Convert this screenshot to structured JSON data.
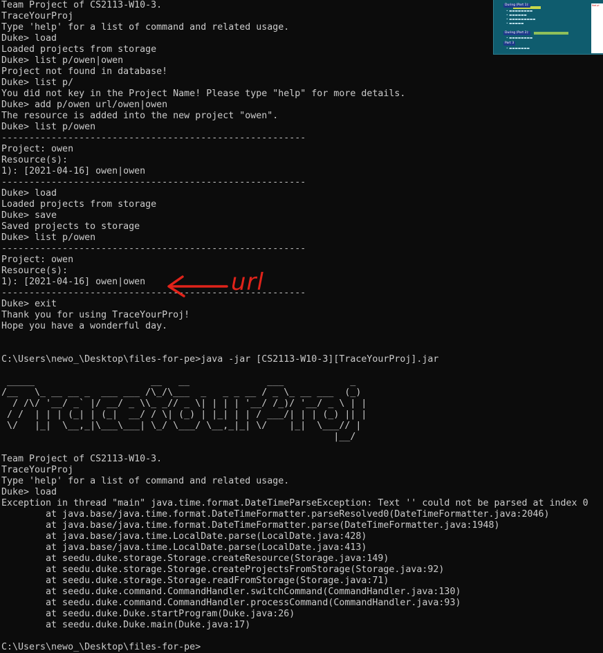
{
  "terminal": {
    "session_one": [
      "Team Project of CS2113-W10-3.",
      "TraceYourProj",
      "Type 'help' for a list of command and related usage.",
      "Duke> load",
      "Loaded projects from storage",
      "Duke> list p/owen|owen",
      "Project not found in database!",
      "Duke> list p/",
      "You did not key in the Project Name! Please type \"help\" for more details.",
      "Duke> add p/owen url/owen|owen",
      "The resource is added into the new project \"owen\".",
      "Duke> list p/owen"
    ],
    "divider": "-------------------------------------------------------",
    "list_block_one": [
      "Project: owen",
      "Resource(s):",
      "1): [2021-04-16] owen|owen"
    ],
    "middle_block": [
      "Duke> load",
      "Loaded projects from storage",
      "Duke> save",
      "Saved projects to storage",
      "Duke> list p/owen"
    ],
    "list_block_two": [
      "Project: owen",
      "Resource(s):",
      "1): [2021-04-16] owen|owen"
    ],
    "exit_block": [
      "Duke> exit",
      "Thank you for using TraceYourProj!",
      "Hope you have a wonderful day."
    ],
    "run_command": "C:\\Users\\newo_\\Desktop\\files-for-pe>java -jar [CS2113-W10-3][TraceYourProj].jar",
    "ascii_logo": [
      " _____                     __   __              ___            _ ",
      "/__   \\_ __ __ _  ___ ___ /\\_/\\___  _   _ _ __ / _ \\_ __ ___  (_)",
      "  / /\\/ '__/ _` |/ __/ _ \\\\_ _// _ \\| | | | '__/ /_)/ '__/ _ \\ | |",
      " / /  | | | (_| | (_|  __/ / \\| (_) | |_| | | / ___/| | | (_) || |",
      " \\/   |_|  \\__,_|\\___\\___| \\_/ \\___/ \\__,_|_| \\/    |_|  \\___// |",
      "                                                            |__/ "
    ],
    "session_two": [
      "Team Project of CS2113-W10-3.",
      "TraceYourProj",
      "Type 'help' for a list of command and related usage.",
      "Duke> load",
      "Exception in thread \"main\" java.time.format.DateTimeParseException: Text '' could not be parsed at index 0",
      "        at java.base/java.time.format.DateTimeFormatter.parseResolved0(DateTimeFormatter.java:2046)",
      "        at java.base/java.time.format.DateTimeFormatter.parse(DateTimeFormatter.java:1948)",
      "        at java.base/java.time.LocalDate.parse(LocalDate.java:428)",
      "        at java.base/java.time.LocalDate.parse(LocalDate.java:413)",
      "        at seedu.duke.storage.Storage.createResource(Storage.java:149)",
      "        at seedu.duke.storage.Storage.createProjectsFromStorage(Storage.java:92)",
      "        at seedu.duke.storage.Storage.readFromStorage(Storage.java:71)",
      "        at seedu.duke.command.CommandHandler.switchCommand(CommandHandler.java:130)",
      "        at seedu.duke.command.CommandHandler.processCommand(CommandHandler.java:93)",
      "        at seedu.duke.Duke.startProgram(Duke.java:26)",
      "        at seedu.duke.Duke.main(Duke.java:17)"
    ],
    "final_prompt": "C:\\Users\\newo_\\Desktop\\files-for-pe>"
  },
  "annotation": {
    "text": "url",
    "color": "#e0231a"
  },
  "thumbnail": {
    "background": "#0f5c6e",
    "chips": [
      "During (Part 1):",
      "During (Part 2):",
      "Part 3"
    ],
    "note": "Not pl"
  },
  "colors": {
    "terminal_bg": "#0c0c0c",
    "terminal_fg": "#cccccc"
  }
}
